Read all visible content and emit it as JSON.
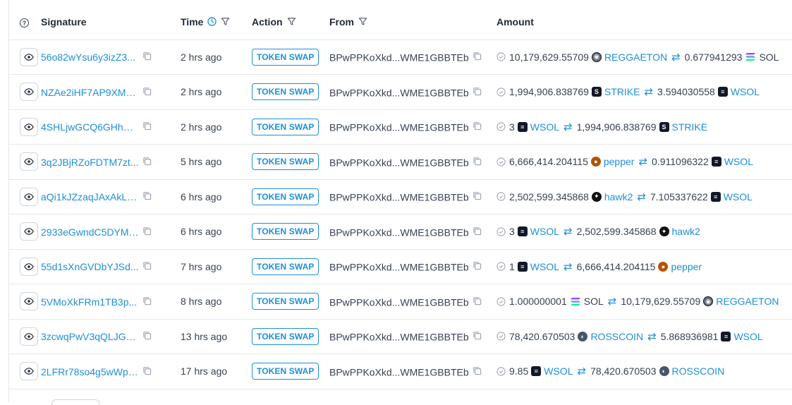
{
  "columns": {
    "info": "?",
    "signature": "Signature",
    "time": "Time",
    "action": "Action",
    "from": "From",
    "amount": "Amount"
  },
  "colors": {
    "link": "#1d8fd8",
    "text": "#374151",
    "border": "#e5e7eb"
  },
  "rows": [
    {
      "signature": "56o82wYsu6y3izZ3...",
      "time": "2 hrs ago",
      "action": "TOKEN SWAP",
      "from": "BPwPPKoXkd...WME1GBBTEb",
      "amount_in": "10,179,629.55709",
      "token_in": "REGGAETON",
      "token_in_icon": "reggaeton-icon",
      "amount_out": "0.677941293",
      "token_out": "SOL",
      "token_out_icon": "sol-icon"
    },
    {
      "signature": "NZAe2iHF7AP9XMx...",
      "time": "2 hrs ago",
      "action": "TOKEN SWAP",
      "from": "BPwPPKoXkd...WME1GBBTEb",
      "amount_in": "1,994,906.838769",
      "token_in": "STRIKE",
      "token_in_icon": "strike-icon",
      "amount_out": "3.594030558",
      "token_out": "WSOL",
      "token_out_icon": "wsol-icon"
    },
    {
      "signature": "4SHLjwGCQ6GHhCe...",
      "time": "2 hrs ago",
      "action": "TOKEN SWAP",
      "from": "BPwPPKoXkd...WME1GBBTEb",
      "amount_in": "3",
      "token_in": "WSOL",
      "token_in_icon": "wsol-icon",
      "amount_out": "1,994,906.838769",
      "token_out": "STRIKE",
      "token_out_icon": "strike-icon"
    },
    {
      "signature": "3q2JBjRZoFDTM7zt...",
      "time": "5 hrs ago",
      "action": "TOKEN SWAP",
      "from": "BPwPPKoXkd...WME1GBBTEb",
      "amount_in": "6,666,414.204115",
      "token_in": "pepper",
      "token_in_icon": "pepper-icon",
      "amount_out": "0.911096322",
      "token_out": "WSOL",
      "token_out_icon": "wsol-icon"
    },
    {
      "signature": "aQi1kJZzaqJAxAkLx...",
      "time": "6 hrs ago",
      "action": "TOKEN SWAP",
      "from": "BPwPPKoXkd...WME1GBBTEb",
      "amount_in": "2,502,599.345868",
      "token_in": "hawk2",
      "token_in_icon": "hawk2-icon",
      "amount_out": "7.105337622",
      "token_out": "WSOL",
      "token_out_icon": "wsol-icon"
    },
    {
      "signature": "2933eGwndC5DYM2...",
      "time": "6 hrs ago",
      "action": "TOKEN SWAP",
      "from": "BPwPPKoXkd...WME1GBBTEb",
      "amount_in": "3",
      "token_in": "WSOL",
      "token_in_icon": "wsol-icon",
      "amount_out": "2,502,599.345868",
      "token_out": "hawk2",
      "token_out_icon": "hawk2-icon"
    },
    {
      "signature": "55d1sXnGVDbYJSd...",
      "time": "7 hrs ago",
      "action": "TOKEN SWAP",
      "from": "BPwPPKoXkd...WME1GBBTEb",
      "amount_in": "1",
      "token_in": "WSOL",
      "token_in_icon": "wsol-icon",
      "amount_out": "6,666,414.204115",
      "token_out": "pepper",
      "token_out_icon": "pepper-icon"
    },
    {
      "signature": "5VMoXkFRm1TB3p...",
      "time": "8 hrs ago",
      "action": "TOKEN SWAP",
      "from": "BPwPPKoXkd...WME1GBBTEb",
      "amount_in": "1.000000001",
      "token_in": "SOL",
      "token_in_icon": "sol-icon",
      "amount_out": "10,179,629.55709",
      "token_out": "REGGAETON",
      "token_out_icon": "reggaeton-icon"
    },
    {
      "signature": "3zcwqPwV3qQLJGK...",
      "time": "13 hrs ago",
      "action": "TOKEN SWAP",
      "from": "BPwPPKoXkd...WME1GBBTEb",
      "amount_in": "78,420.670503",
      "token_in": "ROSSCOIN",
      "token_in_icon": "rosscoin-icon",
      "amount_out": "5.868936981",
      "token_out": "WSOL",
      "token_out_icon": "wsol-icon"
    },
    {
      "signature": "2LFRr78so4g5wWpJ...",
      "time": "17 hrs ago",
      "action": "TOKEN SWAP",
      "from": "BPwPPKoXkd...WME1GBBTEb",
      "amount_in": "9.85",
      "token_in": "WSOL",
      "token_in_icon": "wsol-icon",
      "amount_out": "78,420.670503",
      "token_out": "ROSSCOIN",
      "token_out_icon": "rosscoin-icon"
    }
  ]
}
